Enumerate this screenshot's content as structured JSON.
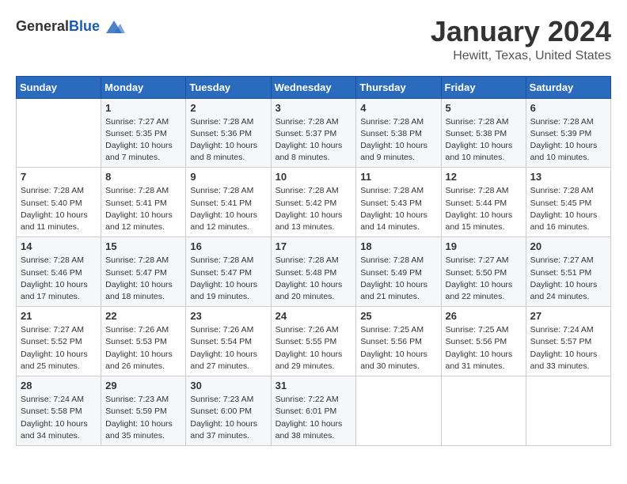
{
  "logo": {
    "general": "General",
    "blue": "Blue"
  },
  "title": "January 2024",
  "subtitle": "Hewitt, Texas, United States",
  "days_header": [
    "Sunday",
    "Monday",
    "Tuesday",
    "Wednesday",
    "Thursday",
    "Friday",
    "Saturday"
  ],
  "weeks": [
    [
      {
        "num": "",
        "text": ""
      },
      {
        "num": "1",
        "text": "Sunrise: 7:27 AM\nSunset: 5:35 PM\nDaylight: 10 hours\nand 7 minutes."
      },
      {
        "num": "2",
        "text": "Sunrise: 7:28 AM\nSunset: 5:36 PM\nDaylight: 10 hours\nand 8 minutes."
      },
      {
        "num": "3",
        "text": "Sunrise: 7:28 AM\nSunset: 5:37 PM\nDaylight: 10 hours\nand 8 minutes."
      },
      {
        "num": "4",
        "text": "Sunrise: 7:28 AM\nSunset: 5:38 PM\nDaylight: 10 hours\nand 9 minutes."
      },
      {
        "num": "5",
        "text": "Sunrise: 7:28 AM\nSunset: 5:38 PM\nDaylight: 10 hours\nand 10 minutes."
      },
      {
        "num": "6",
        "text": "Sunrise: 7:28 AM\nSunset: 5:39 PM\nDaylight: 10 hours\nand 10 minutes."
      }
    ],
    [
      {
        "num": "7",
        "text": "Sunrise: 7:28 AM\nSunset: 5:40 PM\nDaylight: 10 hours\nand 11 minutes."
      },
      {
        "num": "8",
        "text": "Sunrise: 7:28 AM\nSunset: 5:41 PM\nDaylight: 10 hours\nand 12 minutes."
      },
      {
        "num": "9",
        "text": "Sunrise: 7:28 AM\nSunset: 5:41 PM\nDaylight: 10 hours\nand 12 minutes."
      },
      {
        "num": "10",
        "text": "Sunrise: 7:28 AM\nSunset: 5:42 PM\nDaylight: 10 hours\nand 13 minutes."
      },
      {
        "num": "11",
        "text": "Sunrise: 7:28 AM\nSunset: 5:43 PM\nDaylight: 10 hours\nand 14 minutes."
      },
      {
        "num": "12",
        "text": "Sunrise: 7:28 AM\nSunset: 5:44 PM\nDaylight: 10 hours\nand 15 minutes."
      },
      {
        "num": "13",
        "text": "Sunrise: 7:28 AM\nSunset: 5:45 PM\nDaylight: 10 hours\nand 16 minutes."
      }
    ],
    [
      {
        "num": "14",
        "text": "Sunrise: 7:28 AM\nSunset: 5:46 PM\nDaylight: 10 hours\nand 17 minutes."
      },
      {
        "num": "15",
        "text": "Sunrise: 7:28 AM\nSunset: 5:47 PM\nDaylight: 10 hours\nand 18 minutes."
      },
      {
        "num": "16",
        "text": "Sunrise: 7:28 AM\nSunset: 5:47 PM\nDaylight: 10 hours\nand 19 minutes."
      },
      {
        "num": "17",
        "text": "Sunrise: 7:28 AM\nSunset: 5:48 PM\nDaylight: 10 hours\nand 20 minutes."
      },
      {
        "num": "18",
        "text": "Sunrise: 7:28 AM\nSunset: 5:49 PM\nDaylight: 10 hours\nand 21 minutes."
      },
      {
        "num": "19",
        "text": "Sunrise: 7:27 AM\nSunset: 5:50 PM\nDaylight: 10 hours\nand 22 minutes."
      },
      {
        "num": "20",
        "text": "Sunrise: 7:27 AM\nSunset: 5:51 PM\nDaylight: 10 hours\nand 24 minutes."
      }
    ],
    [
      {
        "num": "21",
        "text": "Sunrise: 7:27 AM\nSunset: 5:52 PM\nDaylight: 10 hours\nand 25 minutes."
      },
      {
        "num": "22",
        "text": "Sunrise: 7:26 AM\nSunset: 5:53 PM\nDaylight: 10 hours\nand 26 minutes."
      },
      {
        "num": "23",
        "text": "Sunrise: 7:26 AM\nSunset: 5:54 PM\nDaylight: 10 hours\nand 27 minutes."
      },
      {
        "num": "24",
        "text": "Sunrise: 7:26 AM\nSunset: 5:55 PM\nDaylight: 10 hours\nand 29 minutes."
      },
      {
        "num": "25",
        "text": "Sunrise: 7:25 AM\nSunset: 5:56 PM\nDaylight: 10 hours\nand 30 minutes."
      },
      {
        "num": "26",
        "text": "Sunrise: 7:25 AM\nSunset: 5:56 PM\nDaylight: 10 hours\nand 31 minutes."
      },
      {
        "num": "27",
        "text": "Sunrise: 7:24 AM\nSunset: 5:57 PM\nDaylight: 10 hours\nand 33 minutes."
      }
    ],
    [
      {
        "num": "28",
        "text": "Sunrise: 7:24 AM\nSunset: 5:58 PM\nDaylight: 10 hours\nand 34 minutes."
      },
      {
        "num": "29",
        "text": "Sunrise: 7:23 AM\nSunset: 5:59 PM\nDaylight: 10 hours\nand 35 minutes."
      },
      {
        "num": "30",
        "text": "Sunrise: 7:23 AM\nSunset: 6:00 PM\nDaylight: 10 hours\nand 37 minutes."
      },
      {
        "num": "31",
        "text": "Sunrise: 7:22 AM\nSunset: 6:01 PM\nDaylight: 10 hours\nand 38 minutes."
      },
      {
        "num": "",
        "text": ""
      },
      {
        "num": "",
        "text": ""
      },
      {
        "num": "",
        "text": ""
      }
    ]
  ]
}
